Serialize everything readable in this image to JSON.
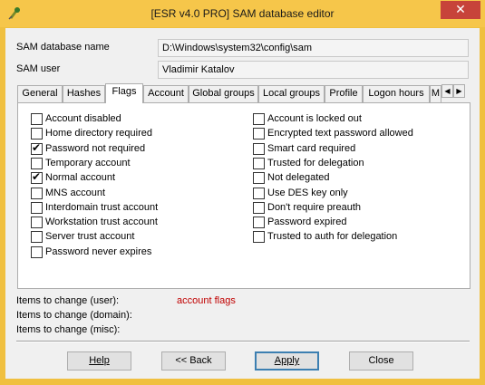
{
  "window": {
    "title": "[ESR v4.0 PRO]  SAM database editor",
    "close_glyph": "✕"
  },
  "fields": {
    "sam_db_label": "SAM database name",
    "sam_db_value": "D:\\Windows\\system32\\config\\sam",
    "sam_user_label": "SAM user",
    "sam_user_value": "Vladimir Katalov"
  },
  "tabs": [
    {
      "label": "General"
    },
    {
      "label": "Hashes"
    },
    {
      "label": "Flags"
    },
    {
      "label": "Account"
    },
    {
      "label": "Global groups"
    },
    {
      "label": "Local groups"
    },
    {
      "label": "Profile"
    },
    {
      "label": "Logon hours"
    },
    {
      "label": "M"
    }
  ],
  "active_tab": "Flags",
  "tab_scroll": {
    "left": "◀",
    "right": "▶"
  },
  "flags_left": [
    {
      "label": "Account disabled",
      "checked": false
    },
    {
      "label": "Home directory required",
      "checked": false
    },
    {
      "label": "Password not required",
      "checked": true
    },
    {
      "label": "Temporary account",
      "checked": false
    },
    {
      "label": "Normal account",
      "checked": true
    },
    {
      "label": "MNS account",
      "checked": false
    },
    {
      "label": "Interdomain trust account",
      "checked": false
    },
    {
      "label": "Workstation trust account",
      "checked": false
    },
    {
      "label": "Server trust account",
      "checked": false
    },
    {
      "label": "Password never expires",
      "checked": false
    }
  ],
  "flags_right": [
    {
      "label": "Account is locked out",
      "checked": false
    },
    {
      "label": "Encrypted text password allowed",
      "checked": false
    },
    {
      "label": "Smart card required",
      "checked": false
    },
    {
      "label": "Trusted for delegation",
      "checked": false
    },
    {
      "label": "Not delegated",
      "checked": false
    },
    {
      "label": "Use DES key only",
      "checked": false
    },
    {
      "label": "Don't require preauth",
      "checked": false
    },
    {
      "label": "Password expired",
      "checked": false
    },
    {
      "label": "Trusted to auth for delegation",
      "checked": false
    }
  ],
  "changes": {
    "user_label": "Items to change (user):",
    "user_value": "account flags",
    "domain_label": "Items to change (domain):",
    "misc_label": "Items to change (misc):"
  },
  "buttons": {
    "help": "Help",
    "back": "<< Back",
    "apply": "Apply",
    "close": "Close"
  },
  "colors": {
    "title_bar": "#f6c64a",
    "close_button": "#c7433a",
    "change_value": "#c00000"
  },
  "check_glyph": "✔"
}
